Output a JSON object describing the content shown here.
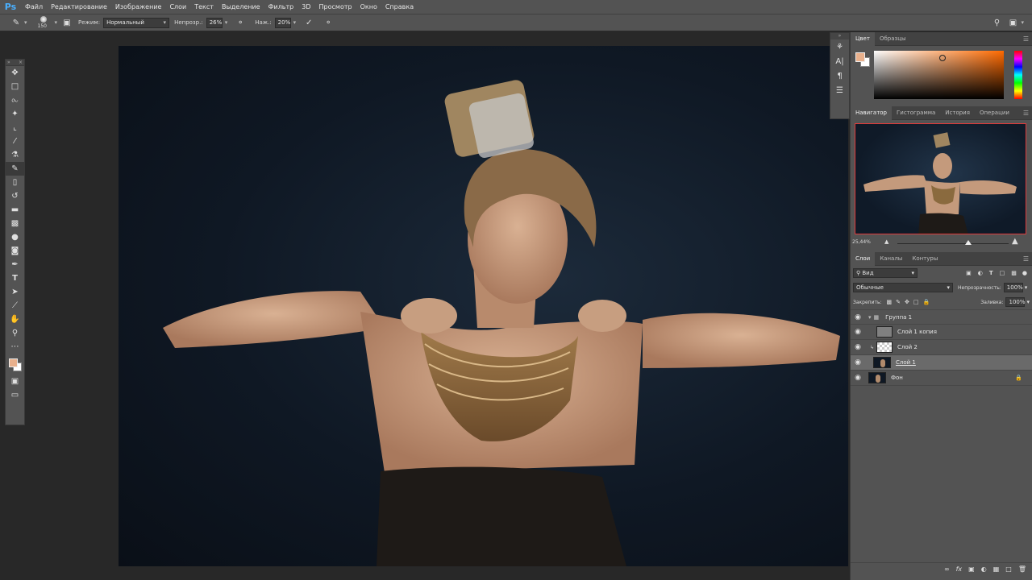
{
  "app": {
    "logo": "Ps"
  },
  "menu": [
    "Файл",
    "Редактирование",
    "Изображение",
    "Слои",
    "Текст",
    "Выделение",
    "Фильтр",
    "3D",
    "Просмотр",
    "Окно",
    "Справка"
  ],
  "options": {
    "brush_size": "150",
    "mode_label": "Режим:",
    "mode_value": "Нормальный",
    "opacity_label": "Непрозр.:",
    "opacity_value": "26%",
    "pressure_label": "Наж.:",
    "pressure_value": "20%"
  },
  "color_panel": {
    "tabs": [
      "Цвет",
      "Образцы"
    ],
    "fg": "#e8b08c",
    "bg": "#ffffff"
  },
  "navigator": {
    "tabs": [
      "Навигатор",
      "Гистограмма",
      "История",
      "Операции"
    ],
    "zoom": "25,44%",
    "zoom_fraction": 0.64
  },
  "layers_panel": {
    "tabs": [
      "Слои",
      "Каналы",
      "Контуры"
    ],
    "filter_label": "Вид",
    "blend_mode": "Обычные",
    "opacity_label": "Непрозрачность:",
    "opacity_value": "100%",
    "lock_label": "Закрепить:",
    "fill_label": "Заливка:",
    "fill_value": "100%",
    "layers": [
      {
        "name": "Группа 1",
        "type": "group"
      },
      {
        "name": "Слой 1 копия",
        "type": "gray"
      },
      {
        "name": "Слой 2",
        "type": "transparent"
      },
      {
        "name": "Слой 1",
        "type": "photo",
        "selected": true
      },
      {
        "name": "Фон",
        "type": "photo",
        "locked": true
      }
    ]
  }
}
